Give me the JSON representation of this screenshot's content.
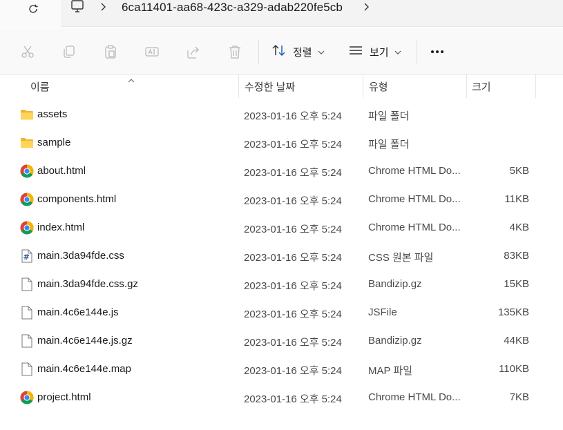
{
  "address": {
    "folder_name": "6ca11401-aa68-423c-a329-adab220fe5cb",
    "icons": [
      "refresh-icon",
      "this-pc-icon",
      "chevron-right-icon"
    ]
  },
  "toolbar": {
    "cut_icon": "scissors-icon",
    "copy_icon": "copy-icon",
    "paste_icon": "clipboard-icon",
    "rename_icon": "rename-icon",
    "share_icon": "share-icon",
    "delete_icon": "trash-icon",
    "sort_label": "정렬",
    "view_label": "보기"
  },
  "columns": {
    "name": "이름",
    "modified": "수정한 날짜",
    "type": "유형",
    "size": "크기"
  },
  "files": [
    {
      "name": "assets",
      "modified": "2023-01-16 오후 5:24",
      "type": "파일 폴더",
      "size": "",
      "icon": "folder"
    },
    {
      "name": "sample",
      "modified": "2023-01-16 오후 5:24",
      "type": "파일 폴더",
      "size": "",
      "icon": "folder"
    },
    {
      "name": "about.html",
      "modified": "2023-01-16 오후 5:24",
      "type": "Chrome HTML Do...",
      "size": "5KB",
      "icon": "chrome"
    },
    {
      "name": "components.html",
      "modified": "2023-01-16 오후 5:24",
      "type": "Chrome HTML Do...",
      "size": "11KB",
      "icon": "chrome"
    },
    {
      "name": "index.html",
      "modified": "2023-01-16 오후 5:24",
      "type": "Chrome HTML Do...",
      "size": "4KB",
      "icon": "chrome"
    },
    {
      "name": "main.3da94fde.css",
      "modified": "2023-01-16 오후 5:24",
      "type": "CSS 원본 파일",
      "size": "83KB",
      "icon": "css"
    },
    {
      "name": "main.3da94fde.css.gz",
      "modified": "2023-01-16 오후 5:24",
      "type": "Bandizip.gz",
      "size": "15KB",
      "icon": "file"
    },
    {
      "name": "main.4c6e144e.js",
      "modified": "2023-01-16 오후 5:24",
      "type": "JSFile",
      "size": "135KB",
      "icon": "file"
    },
    {
      "name": "main.4c6e144e.js.gz",
      "modified": "2023-01-16 오후 5:24",
      "type": "Bandizip.gz",
      "size": "44KB",
      "icon": "file"
    },
    {
      "name": "main.4c6e144e.map",
      "modified": "2023-01-16 오후 5:24",
      "type": "MAP 파일",
      "size": "110KB",
      "icon": "file"
    },
    {
      "name": "project.html",
      "modified": "2023-01-16 오후 5:24",
      "type": "Chrome HTML Do...",
      "size": "7KB",
      "icon": "chrome"
    }
  ]
}
